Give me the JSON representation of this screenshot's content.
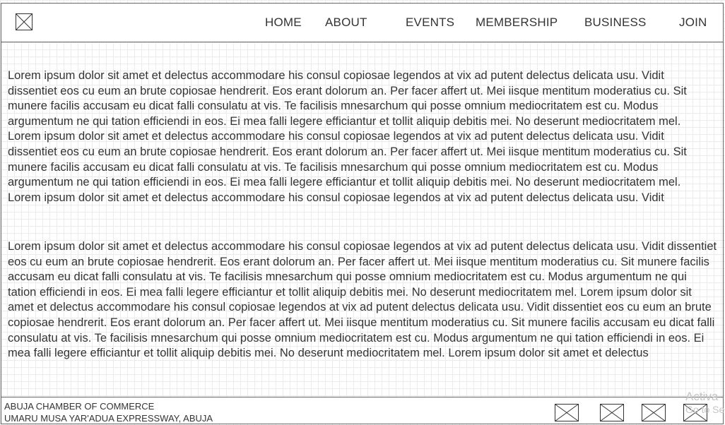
{
  "header": {
    "logo_icon": "image-placeholder-icon",
    "nav": [
      {
        "label": "HOME"
      },
      {
        "label": "ABOUT"
      },
      {
        "label": "EVENTS"
      },
      {
        "label": "MEMBERSHIP"
      },
      {
        "label": "BUSINESS"
      },
      {
        "label": "JOIN"
      }
    ]
  },
  "main": {
    "paragraphs": [
      "Lorem ipsum dolor sit amet et delectus accommodare his consul copiosae legendos at vix ad putent delectus delicata usu. Vidit dissentiet eos cu eum an brute copiosae hendrerit. Eos erant dolorum an. Per facer affert ut. Mei iisque mentitum moderatius cu. Sit munere facilis accusam eu dicat falli consulatu at vis. Te facilisis mnesarchum qui posse omnium mediocritatem est cu. Modus argumentum ne qui tation efficiendi in eos. Ei mea falli legere efficiantur et tollit aliquip debitis mei. No deserunt mediocritatem mel. Lorem ipsum dolor sit amet et delectus accommodare his consul copiosae legendos at vix ad putent delectus delicata usu. Vidit dissentiet eos cu eum an brute copiosae hendrerit. Eos erant dolorum an. Per facer affert ut. Mei iisque mentitum moderatius cu. Sit munere facilis accusam eu dicat falli consulatu at vis. Te facilisis mnesarchum qui posse omnium mediocritatem est cu. Modus argumentum ne qui tation efficiendi in eos. Ei mea falli legere efficiantur et tollit aliquip debitis mei. No deserunt mediocritatem mel. Lorem ipsum dolor sit amet et delectus accommodare his consul copiosae legendos at vix ad putent delectus delicata usu. Vidit",
      "Lorem ipsum dolor sit amet et delectus accommodare his consul copiosae legendos at vix ad putent delectus delicata usu. Vidit dissentiet eos cu eum an brute copiosae hendrerit. Eos erant dolorum an. Per facer affert ut. Mei iisque mentitum moderatius cu. Sit munere facilis accusam eu dicat falli consulatu at vis. Te facilisis mnesarchum qui posse omnium mediocritatem est cu. Modus argumentum ne qui tation efficiendi in eos. Ei mea falli legere efficiantur et tollit aliquip debitis mei. No deserunt mediocritatem mel. Lorem ipsum dolor sit amet et delectus accommodare his consul copiosae legendos at vix ad putent delectus delicata usu. Vidit dissentiet eos cu eum an brute copiosae hendrerit. Eos erant dolorum an. Per facer affert ut. Mei iisque mentitum moderatius cu. Sit munere facilis accusam eu dicat falli consulatu at vis. Te facilisis mnesarchum qui posse omnium mediocritatem est cu. Modus argumentum ne qui tation efficiendi in eos. Ei mea falli legere efficiantur et tollit aliquip debitis mei. No deserunt mediocritatem mel. Lorem ipsum dolor sit amet et delectus"
    ]
  },
  "footer": {
    "org_name": "ABUJA CHAMBER OF COMMERCE",
    "address": "UMARU MUSA YAR'ADUA EXPRESSWAY, ABUJA",
    "social_icons": [
      "image-placeholder-icon",
      "image-placeholder-icon",
      "image-placeholder-icon",
      "image-placeholder-icon"
    ]
  },
  "watermark": {
    "line1": "Activa",
    "line2": "Go to Se"
  },
  "colors": {
    "text": "#333333",
    "border": "#666666",
    "grid": "#ececec",
    "watermark": "#c4c4c4"
  }
}
